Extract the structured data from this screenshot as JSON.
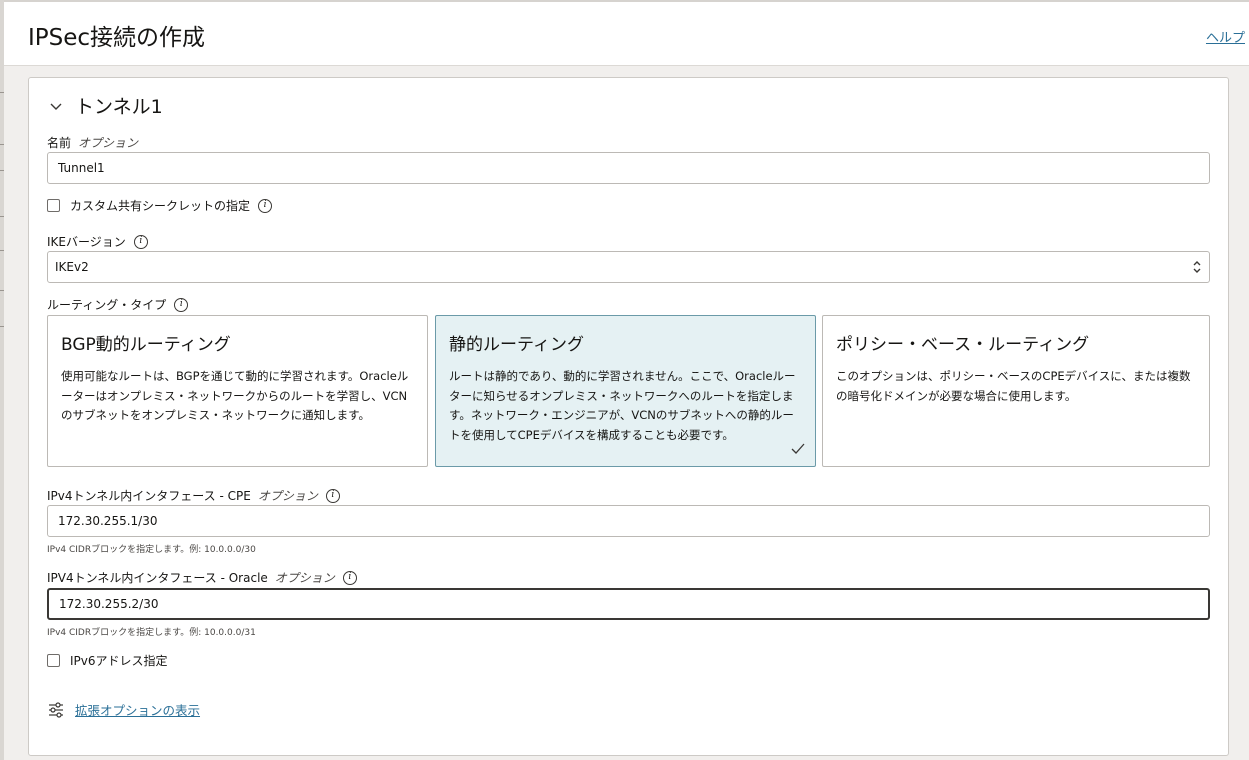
{
  "header": {
    "title": "IPSec接続の作成",
    "help": "ヘルプ"
  },
  "section": {
    "title": "トンネル1"
  },
  "name_field": {
    "label": "名前",
    "optional": "オプション",
    "value": "Tunnel1"
  },
  "custom_secret": {
    "label": "カスタム共有シークレットの指定",
    "checked": false
  },
  "ike": {
    "label": "IKEバージョン",
    "value": "IKEv2"
  },
  "routing": {
    "label": "ルーティング・タイプ",
    "cards": [
      {
        "title": "BGP動的ルーティング",
        "desc": "使用可能なルートは、BGPを通じて動的に学習されます。Oracleルーターはオンプレミス・ネットワークからのルートを学習し、VCNのサブネットをオンプレミス・ネットワークに通知します。",
        "selected": false
      },
      {
        "title": "静的ルーティング",
        "desc": "ルートは静的であり、動的に学習されません。ここで、Oracleルーターに知らせるオンプレミス・ネットワークへのルートを指定します。ネットワーク・エンジニアが、VCNのサブネットへの静的ルートを使用してCPEデバイスを構成することも必要です。",
        "selected": true
      },
      {
        "title": "ポリシー・ベース・ルーティング",
        "desc": "このオプションは、ポリシー・ベースのCPEデバイスに、または複数の暗号化ドメインが必要な場合に使用します。",
        "selected": false
      }
    ]
  },
  "cpe_field": {
    "label": "IPv4トンネル内インタフェース - CPE",
    "optional": "オプション",
    "value": "172.30.255.1/30",
    "hint": "IPv4 CIDRブロックを指定します。例: 10.0.0.0/30"
  },
  "oracle_field": {
    "label": "IPV4トンネル内インタフェース - Oracle",
    "optional": "オプション",
    "value": "172.30.255.2/30",
    "hint": "IPv4 CIDRブロックを指定します。例: 10.0.0.0/31"
  },
  "ipv6": {
    "label": "IPv6アドレス指定",
    "checked": false
  },
  "advanced": {
    "label": "拡張オプションの表示"
  },
  "colors": {
    "accent": "#2a6f97",
    "selected_card_bg": "#e5f1f3",
    "text": "#161513"
  }
}
